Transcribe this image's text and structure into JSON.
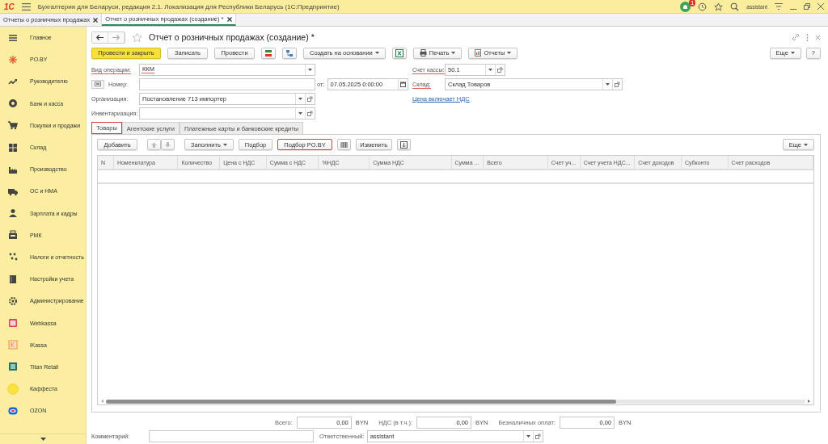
{
  "app_bar": {
    "logo": "1С",
    "title": "Бухгалтерия для Беларуси, редакция 2.1. Локализация для Республики Беларусь   (1С:Предприятие)",
    "notifications": "1",
    "user": "assistant"
  },
  "open_tabs": [
    {
      "label": "Отчеты о розничных продажах",
      "selected": false
    },
    {
      "label": "Отчет о розничных продажах (создание) *",
      "selected": true
    }
  ],
  "sidebar": {
    "items": [
      {
        "label": "Главное"
      },
      {
        "label": "PO.BY"
      },
      {
        "label": "Руководителю"
      },
      {
        "label": "Банк и касса"
      },
      {
        "label": "Покупки и продажи"
      },
      {
        "label": "Склад"
      },
      {
        "label": "Производство"
      },
      {
        "label": "ОС и НМА"
      },
      {
        "label": "Зарплата и кадры"
      },
      {
        "label": "РМК"
      },
      {
        "label": "Налоги и отчетность"
      },
      {
        "label": "Настройки учета"
      },
      {
        "label": "Администрирование"
      },
      {
        "label": "Webkassa"
      },
      {
        "label": "iKassa"
      },
      {
        "label": "Titan Retail"
      },
      {
        "label": "Каффеста"
      },
      {
        "label": "OZON"
      }
    ]
  },
  "document": {
    "title": "Отчет о розничных продажах (создание) *",
    "toolbar": {
      "post_and_close": "Провести и закрыть",
      "save": "Записать",
      "post": "Провести",
      "create_based_on": "Создать на основании",
      "print": "Печать",
      "reports": "Отчеты",
      "more": "Еще",
      "help": "?"
    },
    "operation_type": {
      "label": "Вид операции:",
      "value": "ККМ",
      "required": true
    },
    "number": {
      "label": "Номер:"
    },
    "date": {
      "label": "от:",
      "value": "07.05.2025  0:00:00"
    },
    "organization": {
      "label": "Организация:",
      "value": "Постановление 713 импортер",
      "required": false
    },
    "inventory": {
      "label": "Инвентаризация:"
    },
    "cash_account": {
      "label": "Счет кассы:",
      "value": "50.1",
      "required": true
    },
    "warehouse": {
      "label": "Склад:",
      "value": "Склад Товаров",
      "required": true
    },
    "price_includes_vat_link": "Цена включает НДС",
    "section_tabs": [
      {
        "label": "Товары",
        "selected": true,
        "highlighted": true
      },
      {
        "label": "Агентские услуги",
        "selected": false,
        "highlighted": false
      },
      {
        "label": "Платежные карты и банковские кредиты",
        "selected": false,
        "highlighted": false
      }
    ],
    "table_toolbar": {
      "add": "Добавить",
      "fill": "Заполнить",
      "pick": "Подбор",
      "pick_poby": {
        "label": "Подбор PO.BY",
        "highlighted": true
      },
      "change": "Изменить",
      "more": "Еще"
    },
    "table": {
      "columns": [
        "N",
        "Номенклатура",
        "Количество",
        "Цена с НДС",
        "Сумма с НДС",
        "%НДС",
        "Сумма НДС",
        "Сумма ...",
        "Всего",
        "Счет уч...",
        "Счет учета НДС...",
        "Счет доходов",
        "Субконто",
        "Счет расходов"
      ]
    },
    "totals": [
      {
        "label": "Всего:",
        "value": "0,00",
        "currency": "BYN"
      },
      {
        "label": "НДС (в т.ч.):",
        "value": "0,00",
        "currency": "BYN"
      },
      {
        "label": "Безналичных оплат:",
        "value": "0,00",
        "currency": "BYN"
      }
    ],
    "comment": {
      "label": "Комментарий:"
    },
    "responsible": {
      "label": "Ответственный:",
      "value": "assistant"
    }
  }
}
